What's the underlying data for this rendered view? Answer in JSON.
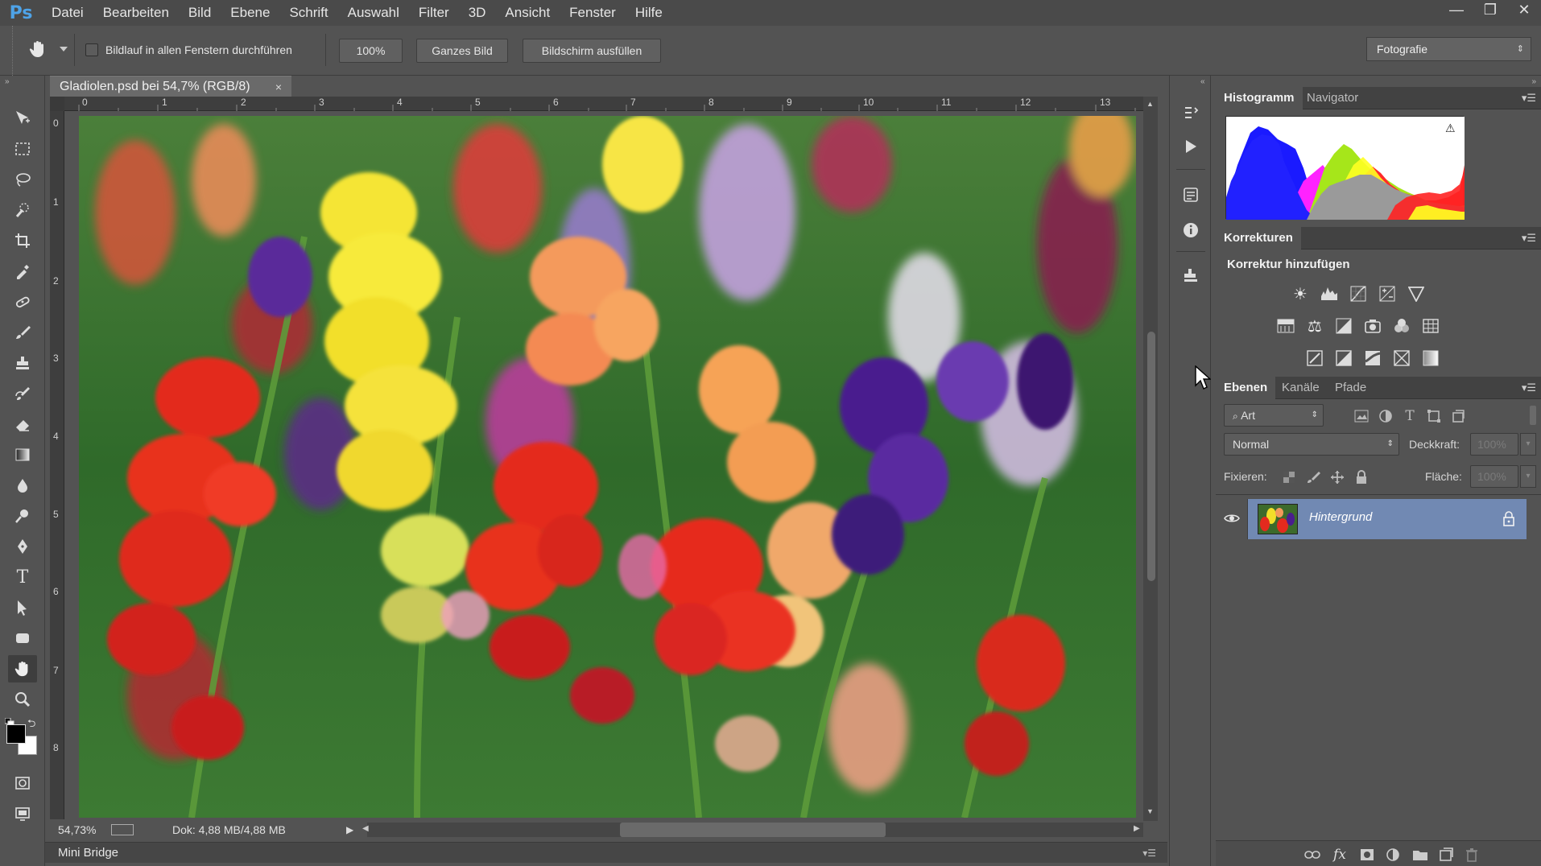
{
  "app": {
    "logo": "Ps"
  },
  "menu": [
    "Datei",
    "Bearbeiten",
    "Bild",
    "Ebene",
    "Schrift",
    "Auswahl",
    "Filter",
    "3D",
    "Ansicht",
    "Fenster",
    "Hilfe"
  ],
  "window_controls": {
    "minimize": "—",
    "restore": "❐",
    "close": "✕"
  },
  "options": {
    "scroll_all_label": "Bildlauf in allen Fenstern durchführen",
    "scroll_all_checked": false,
    "zoom_100": "100%",
    "fit_screen": "Ganzes Bild",
    "fill_screen": "Bildschirm ausfüllen",
    "workspace": "Fotografie"
  },
  "document": {
    "tab_title": "Gladiolen.psd bei 54,7% (RGB/8)",
    "close": "×",
    "ruler_top": [
      "0",
      "1",
      "2",
      "3",
      "4",
      "5",
      "6",
      "7",
      "8",
      "9",
      "10",
      "11",
      "12",
      "13"
    ],
    "ruler_left": [
      "0",
      "1",
      "2",
      "3",
      "4",
      "5",
      "6",
      "7",
      "8"
    ]
  },
  "status": {
    "zoom": "54,73%",
    "doc_info": "Dok: 4,88 MB/4,88 MB"
  },
  "minibridge": {
    "label": "Mini Bridge"
  },
  "panels": {
    "histogram_tabs": [
      "Histogramm",
      "Navigator"
    ],
    "histogram_warning": "⚠",
    "corrections_tab": "Korrekturen",
    "corrections_title": "Korrektur hinzufügen",
    "layers_tabs": [
      "Ebenen",
      "Kanäle",
      "Pfade"
    ],
    "filter_kind": "Art",
    "blend_mode": "Normal",
    "opacity_label": "Deckkraft:",
    "opacity_value": "100%",
    "lock_label": "Fixieren:",
    "fill_label": "Fläche:",
    "fill_value": "100%",
    "layer_name": "Hintergrund"
  },
  "colors": {
    "accent_selection": "#7189b3",
    "foreground": "#000000",
    "background": "#ffffff"
  }
}
